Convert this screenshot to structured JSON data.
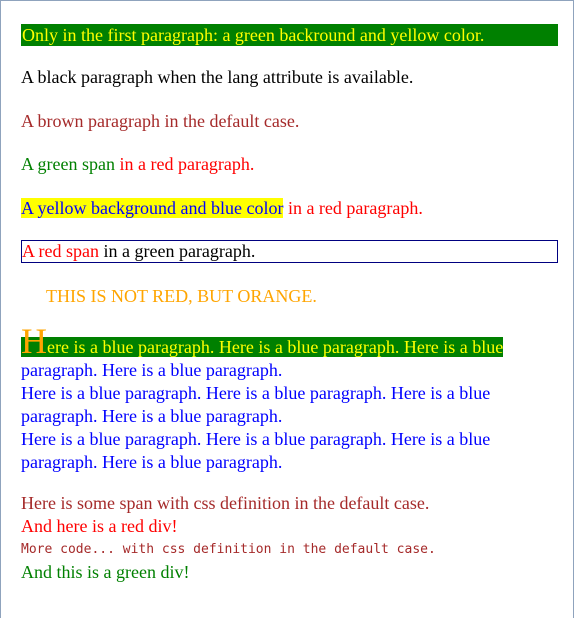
{
  "p1": "Only in the first paragraph: a green backround and yellow color.",
  "p2": "A black paragraph when the lang attribute is available.",
  "p3": "A brown paragraph in the default case.",
  "p4": {
    "green_span": "A green span",
    "rest": " in a red paragraph."
  },
  "p5": {
    "yellow_span": "A yellow background and blue color",
    "rest": " in a red paragraph."
  },
  "p6": {
    "red_span": "A red span",
    "rest": " in a green paragraph."
  },
  "p7": "THIS IS NOT RED, BUT ORANGE.",
  "blue": {
    "dropcap": "H",
    "line1_rest": "ere is a blue paragraph. Here is a blue paragraph. Here is a blue",
    "line2": "paragraph. Here is a blue paragraph.",
    "p2_line1": "Here is a blue paragraph. Here is a blue paragraph. Here is a blue",
    "p2_line2": "paragraph. Here is a blue paragraph.",
    "p3_line1": "Here is a blue paragraph. Here is a blue paragraph. Here is a blue",
    "p3_line2": "paragraph. Here is a blue paragraph."
  },
  "span_line": "Here is some span with css definition in the default case.",
  "red_div": "And here is a red div!",
  "code_line": "More code... with css definition in the default case.",
  "green_div": "And this is a green div!",
  "colors": {
    "green": "#008000",
    "yellow": "#ffff00",
    "brown": "#a52a2a",
    "red": "#ff0000",
    "blue": "#0000ff",
    "orange": "#ffa500",
    "border": "#000080"
  }
}
